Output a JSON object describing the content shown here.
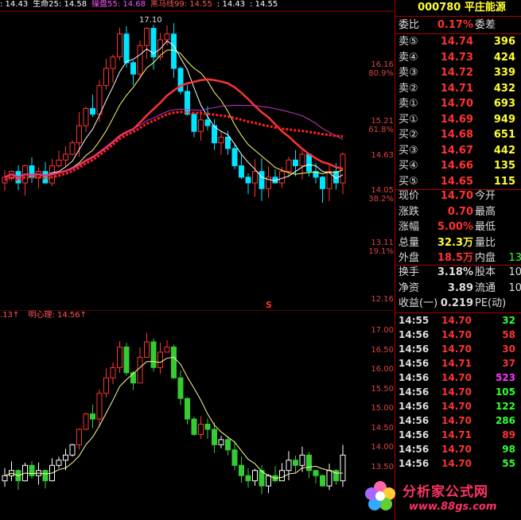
{
  "top_bar": {
    "items": [
      {
        "text": ": 14.43",
        "color": "#ffffff"
      },
      {
        "text": "生命25: 14.58",
        "color": "#ffffff"
      },
      {
        "text": "操盘55: 14.68",
        "color": "#ff55ff"
      },
      {
        "text": "黑马线99: 14.55",
        "color": "#ff5555"
      },
      {
        "text": ": 14.43",
        "color": "#ffffff"
      },
      {
        "text": ": 14.55",
        "color": "#ffffff"
      }
    ]
  },
  "upper_chart": {
    "peak_label": "17.10",
    "marker": "S",
    "axis": [
      {
        "label": "16.16",
        "pct": "80.9%"
      },
      {
        "label": "15.21",
        "pct": "61.8%"
      },
      {
        "label": "14.63",
        "pct": ""
      },
      {
        "label": "14.05",
        "pct": "38.2%"
      },
      {
        "label": "13.11",
        "pct": "19.1%"
      },
      {
        "label": "12.16",
        "pct": ""
      }
    ]
  },
  "lower_chart": {
    "label_left": ".13↑",
    "label_main": "明心理: 14.56↑",
    "axis": [
      "17.00",
      "16.50",
      "16.00",
      "15.50",
      "15.00",
      "14.50",
      "14.00",
      "13.50"
    ]
  },
  "stock": {
    "code": "000780",
    "name": "平庄能源"
  },
  "ratio": {
    "label": "委比",
    "value": "0.17%",
    "label2": "委差"
  },
  "sell": [
    {
      "label": "卖⑤",
      "price": "14.74",
      "vol": "396"
    },
    {
      "label": "卖④",
      "price": "14.73",
      "vol": "424"
    },
    {
      "label": "卖③",
      "price": "14.72",
      "vol": "339"
    },
    {
      "label": "卖②",
      "price": "14.71",
      "vol": "432"
    },
    {
      "label": "卖①",
      "price": "14.70",
      "vol": "693"
    }
  ],
  "buy": [
    {
      "label": "买①",
      "price": "14.69",
      "vol": "949"
    },
    {
      "label": "买②",
      "price": "14.68",
      "vol": "651"
    },
    {
      "label": "买③",
      "price": "14.67",
      "vol": "442"
    },
    {
      "label": "买④",
      "price": "14.66",
      "vol": "135"
    },
    {
      "label": "买⑤",
      "price": "14.65",
      "vol": "115"
    }
  ],
  "quote": [
    {
      "l1": "现价",
      "v1": "14.70",
      "l2": "今开",
      "c": "#ff3333"
    },
    {
      "l1": "涨跌",
      "v1": "0.70",
      "l2": "最高",
      "c": "#ff3333"
    },
    {
      "l1": "涨幅",
      "v1": "5.00%",
      "l2": "最低",
      "c": "#ff3333"
    },
    {
      "l1": "总量",
      "v1": "32.3万",
      "l2": "量比",
      "c": "#ffff33"
    },
    {
      "l1": "外盘",
      "v1": "18.5万",
      "l2": "内盘",
      "c": "#ff3333",
      "v2": "13",
      "c2": "#33ff33"
    }
  ],
  "fin": [
    {
      "l1": "换手",
      "v1": "3.18%",
      "l2": "股本",
      "v2": "10"
    },
    {
      "l1": "净资",
      "v1": "3.89",
      "l2": "流通",
      "v2": "10"
    },
    {
      "l1": "收益(一)",
      "v1": "0.219",
      "l2": "PE(动)",
      "v2": ""
    }
  ],
  "trades": [
    {
      "time": "14:55",
      "price": "14.70",
      "vol": "32",
      "c": "#33ff33"
    },
    {
      "time": "14:56",
      "price": "14.70",
      "vol": "58",
      "c": "#ff3333"
    },
    {
      "time": "14:56",
      "price": "14.70",
      "vol": "30",
      "c": "#ff3333"
    },
    {
      "time": "14:56",
      "price": "14.71",
      "vol": "37",
      "c": "#ff3333"
    },
    {
      "time": "14:56",
      "price": "14.70",
      "vol": "523",
      "c": "#ff33ff"
    },
    {
      "time": "14:56",
      "price": "14.70",
      "vol": "105",
      "c": "#33ff33"
    },
    {
      "time": "14:56",
      "price": "14.70",
      "vol": "122",
      "c": "#33ff33"
    },
    {
      "time": "14:56",
      "price": "14.70",
      "vol": "286",
      "c": "#33ff33"
    },
    {
      "time": "14:56",
      "price": "14.71",
      "vol": "89",
      "c": "#ff3333"
    },
    {
      "time": "14:56",
      "price": "14.70",
      "vol": "98",
      "c": "#33ff33"
    },
    {
      "time": "14:56",
      "price": "14.70",
      "vol": "55",
      "c": "#33ff33"
    }
  ],
  "watermark": {
    "title": "分析家公式网",
    "url": "www.88gs.com"
  },
  "colors": {
    "up": "#ff3333",
    "down": "#00e5ff",
    "grid": "#a00000"
  }
}
